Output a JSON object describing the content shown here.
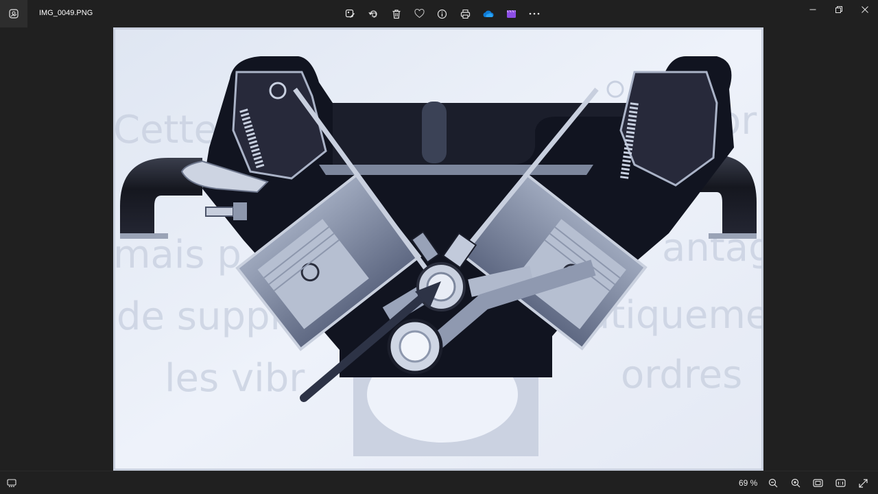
{
  "window": {
    "filename": "IMG_0049.PNG"
  },
  "toolbar": {
    "icons": [
      "edit-image-icon",
      "rotate-icon",
      "delete-icon",
      "favorite-icon",
      "info-icon",
      "print-icon",
      "onedrive-icon",
      "clipchamp-icon",
      "more-icon"
    ]
  },
  "photo": {
    "watermark_lines": [
      "Cette",
      "metor",
      "mais p",
      "antag",
      "de supprim",
      "atiquemer",
      "les vibr",
      "ordres"
    ]
  },
  "statusbar": {
    "zoom": "69 %"
  },
  "colors": {
    "chrome_bg": "#202020",
    "onedrive": "#0f7bd6",
    "clipchamp": "#8d4ee6"
  }
}
